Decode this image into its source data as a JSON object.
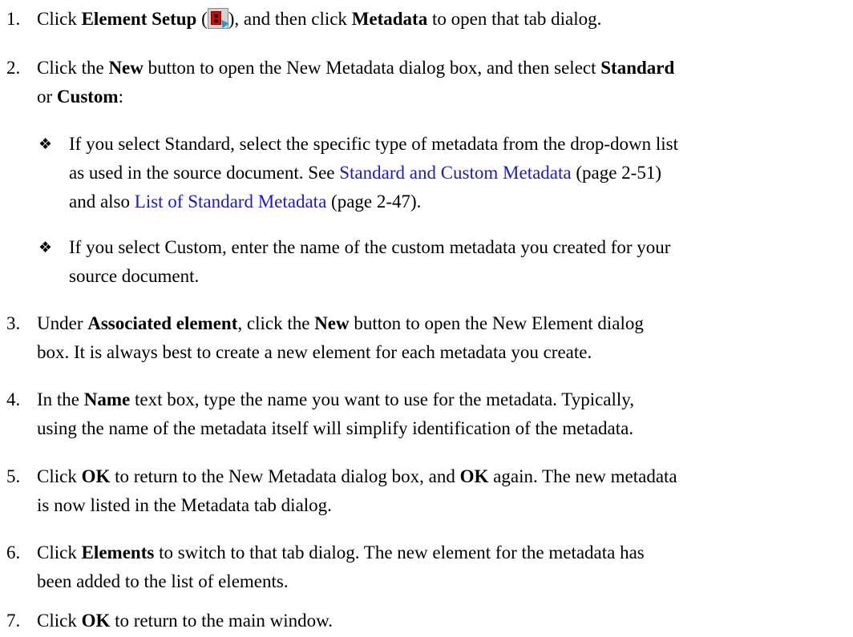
{
  "steps": [
    {
      "num": "1.",
      "parts": [
        {
          "t": "Click "
        },
        {
          "b": "Element Setup"
        },
        {
          "t": " ("
        },
        {
          "icon": "element-setup-icon"
        },
        {
          "t": "), and then click "
        },
        {
          "b": "Metadata"
        },
        {
          "t": " to open that tab dialog."
        }
      ]
    },
    {
      "num": "2.",
      "parts": [
        {
          "t": "Click the "
        },
        {
          "b": "New"
        },
        {
          "t": " button to open the New Metadata dialog box, and then select "
        },
        {
          "b": "Standard"
        },
        {
          "br": true
        },
        {
          "t": "or "
        },
        {
          "b": "Custom"
        },
        {
          "t": ":"
        }
      ]
    },
    {
      "num": "3.",
      "parts": [
        {
          "t": "Under "
        },
        {
          "b": "Associated element"
        },
        {
          "t": ", click the "
        },
        {
          "b": "New"
        },
        {
          "t": " button to open the New Element dialog"
        },
        {
          "br": true
        },
        {
          "t": "box. It is always best to create a new element for each metadata you create."
        }
      ]
    },
    {
      "num": "4.",
      "parts": [
        {
          "t": "In the "
        },
        {
          "b": "Name"
        },
        {
          "t": " text box, type the name you want to use for the metadata. Typically,"
        },
        {
          "br": true
        },
        {
          "t": "using the name of the metadata itself will simplify identification of the metadata."
        }
      ]
    },
    {
      "num": "5.",
      "parts": [
        {
          "t": "Click "
        },
        {
          "b": "OK"
        },
        {
          "t": " to return to the New Metadata dialog box, and "
        },
        {
          "b": "OK"
        },
        {
          "t": " again. The new metadata"
        },
        {
          "br": true
        },
        {
          "t": "is now listed in the Metadata tab dialog."
        }
      ]
    },
    {
      "num": "6.",
      "parts": [
        {
          "t": "Click "
        },
        {
          "b": "Elements"
        },
        {
          "t": " to switch to that tab dialog. The new element for the metadata has"
        },
        {
          "br": true
        },
        {
          "t": "been added to the list of elements."
        }
      ]
    },
    {
      "num": "7.",
      "parts": [
        {
          "t": "Click "
        },
        {
          "b": "OK"
        },
        {
          "t": " to return to the main window."
        }
      ]
    }
  ],
  "bullets": [
    {
      "mark": "❖",
      "parts": [
        {
          "t": "If you select Standard, select the specific type of metadata from the drop-down list"
        },
        {
          "br": true
        },
        {
          "t": "as used in the source document. See "
        },
        {
          "link": "Standard and Custom Metadata"
        },
        {
          "t": " (page 2-51)"
        },
        {
          "br": true
        },
        {
          "t": "and also "
        },
        {
          "link": "List of Standard Metadata"
        },
        {
          "t": " (page 2-47)."
        }
      ]
    },
    {
      "mark": "❖",
      "parts": [
        {
          "t": "If you select Custom, enter the name of the custom metadata you created for your"
        },
        {
          "br": true
        },
        {
          "t": "source document."
        }
      ]
    }
  ]
}
